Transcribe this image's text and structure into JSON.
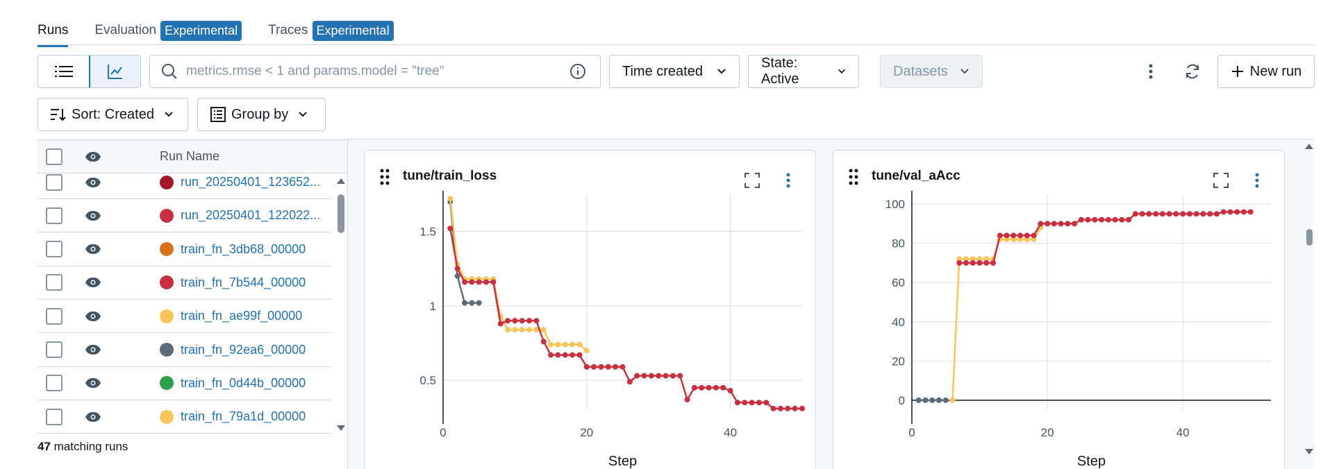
{
  "tabs": [
    {
      "label": "Runs",
      "badge": ""
    },
    {
      "label": "Evaluation",
      "badge": "Experimental"
    },
    {
      "label": "Traces",
      "badge": "Experimental"
    }
  ],
  "toolbar": {
    "search_placeholder": "metrics.rmse < 1 and params.model = \"tree\"",
    "time_created": "Time created",
    "state": "State: Active",
    "datasets": "Datasets",
    "new_run": "New run",
    "sort": "Sort: Created",
    "group_by": "Group by"
  },
  "table": {
    "header_run_name": "Run Name",
    "rows": [
      {
        "name": "run_20250401_123652...",
        "color": "#a3172b"
      },
      {
        "name": "run_20250401_122022...",
        "color": "#c8303f"
      },
      {
        "name": "train_fn_3db68_00000",
        "color": "#d9711c"
      },
      {
        "name": "train_fn_7b544_00000",
        "color": "#c8303f"
      },
      {
        "name": "train_fn_ae99f_00000",
        "color": "#f7c55a"
      },
      {
        "name": "train_fn_92ea6_00000",
        "color": "#5f6c78"
      },
      {
        "name": "train_fn_0d44b_00000",
        "color": "#2e9e4f"
      },
      {
        "name": "train_fn_79a1d_00000",
        "color": "#f7c55a"
      }
    ],
    "matching_count": "47",
    "matching_label": "matching runs"
  },
  "chart_data": [
    {
      "type": "line",
      "title": "tune/train_loss",
      "xlabel": "Step",
      "xlim": [
        0,
        50
      ],
      "ylim": [
        0.3,
        1.75
      ],
      "xticks": [
        "0",
        "20",
        "40"
      ],
      "yticks": [
        "0.5",
        "1",
        "1.5"
      ],
      "series": [
        {
          "color": "#5f6c78",
          "x": [
            1,
            2,
            3,
            4,
            5
          ],
          "y": [
            1.7,
            1.2,
            1.02,
            1.02,
            1.02
          ]
        },
        {
          "color": "#f7c55a",
          "x": [
            1,
            2,
            3,
            4,
            5,
            6,
            7,
            8,
            9,
            10,
            11,
            12,
            13,
            14,
            15,
            16,
            17,
            18,
            19,
            20
          ],
          "y": [
            1.72,
            1.28,
            1.18,
            1.18,
            1.18,
            1.18,
            1.18,
            0.93,
            0.84,
            0.84,
            0.84,
            0.84,
            0.84,
            0.84,
            0.74,
            0.74,
            0.74,
            0.74,
            0.74,
            0.7
          ]
        },
        {
          "color": "#c8303f",
          "x": [
            1,
            2,
            3,
            4,
            5,
            6,
            7,
            8,
            9,
            10,
            11,
            12,
            13,
            14,
            15,
            16,
            17,
            18,
            19,
            20,
            21,
            22,
            23,
            24,
            25,
            26,
            27,
            28,
            29,
            30,
            31,
            32,
            33,
            34,
            35,
            36,
            37,
            38,
            39,
            40,
            41,
            42,
            43,
            44,
            45,
            46,
            47,
            48,
            49,
            50
          ],
          "y": [
            1.52,
            1.25,
            1.16,
            1.16,
            1.16,
            1.16,
            1.16,
            0.88,
            0.9,
            0.9,
            0.9,
            0.9,
            0.9,
            0.76,
            0.67,
            0.67,
            0.67,
            0.67,
            0.67,
            0.59,
            0.59,
            0.59,
            0.59,
            0.59,
            0.59,
            0.49,
            0.53,
            0.53,
            0.53,
            0.53,
            0.53,
            0.53,
            0.53,
            0.37,
            0.45,
            0.45,
            0.45,
            0.45,
            0.45,
            0.43,
            0.35,
            0.35,
            0.35,
            0.35,
            0.35,
            0.31,
            0.31,
            0.31,
            0.31,
            0.31
          ]
        }
      ]
    },
    {
      "type": "line",
      "title": "tune/val_aAcc",
      "xlabel": "Step",
      "xlim": [
        0,
        53
      ],
      "ylim": [
        -5,
        105
      ],
      "xticks": [
        "0",
        "20",
        "40"
      ],
      "yticks": [
        "0",
        "20",
        "40",
        "60",
        "80",
        "100"
      ],
      "series": [
        {
          "color": "#5f6c78",
          "x": [
            1,
            2,
            3,
            4,
            5
          ],
          "y": [
            0,
            0,
            0,
            0,
            0
          ]
        },
        {
          "color": "#f7c55a",
          "x": [
            6,
            7,
            8,
            9,
            10,
            11,
            12,
            13,
            14,
            15,
            16,
            17,
            18,
            19
          ],
          "y": [
            0,
            72,
            72,
            72,
            72,
            72,
            72,
            82,
            82,
            82,
            82,
            82,
            82,
            88
          ]
        },
        {
          "color": "#c8303f",
          "x": [
            7,
            8,
            9,
            10,
            11,
            12,
            13,
            14,
            15,
            16,
            17,
            18,
            19,
            20,
            21,
            22,
            23,
            24,
            25,
            26,
            27,
            28,
            29,
            30,
            31,
            32,
            33,
            34,
            35,
            36,
            37,
            38,
            39,
            40,
            41,
            42,
            43,
            44,
            45,
            46,
            47,
            48,
            49,
            50
          ],
          "y": [
            70,
            70,
            70,
            70,
            70,
            70,
            84,
            84,
            84,
            84,
            84,
            84,
            90,
            90,
            90,
            90,
            90,
            90,
            92,
            92,
            92,
            92,
            92,
            92,
            92,
            92,
            95,
            95,
            95,
            95,
            95,
            95,
            95,
            95,
            95,
            95,
            95,
            95,
            95,
            96,
            96,
            96,
            96,
            96
          ]
        }
      ]
    }
  ]
}
